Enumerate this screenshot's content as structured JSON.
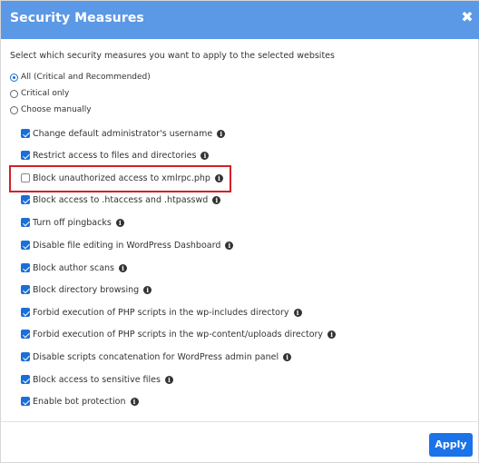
{
  "dialog": {
    "title": "Security Measures",
    "close_glyph": "✖",
    "intro": "Select which security measures you want to apply to the selected websites",
    "radio_options": [
      {
        "label": "All (Critical and Recommended)",
        "checked": true
      },
      {
        "label": "Critical only",
        "checked": false
      },
      {
        "label": "Choose manually",
        "checked": false
      }
    ],
    "measures": [
      {
        "label": "Change default administrator's username",
        "checked": true
      },
      {
        "label": "Restrict access to files and directories",
        "checked": true
      },
      {
        "label": "Block unauthorized access to xmlrpc.php",
        "checked": false
      },
      {
        "label": "Block access to .htaccess and .htpasswd",
        "checked": true
      },
      {
        "label": "Turn off pingbacks",
        "checked": true
      },
      {
        "label": "Disable file editing in WordPress Dashboard",
        "checked": true
      },
      {
        "label": "Block author scans",
        "checked": true
      },
      {
        "label": "Block directory browsing",
        "checked": true
      },
      {
        "label": "Forbid execution of PHP scripts in the wp-includes directory",
        "checked": true
      },
      {
        "label": "Forbid execution of PHP scripts in the wp-content/uploads directory",
        "checked": true
      },
      {
        "label": "Disable scripts concatenation for WordPress admin panel",
        "checked": true
      },
      {
        "label": "Block access to sensitive files",
        "checked": true
      },
      {
        "label": "Enable bot protection",
        "checked": true
      }
    ],
    "info_glyph": "i",
    "apply_label": "Apply"
  },
  "colors": {
    "header_bg": "#5b98e6",
    "accent": "#1a73e8",
    "highlight_border": "#d32027"
  }
}
